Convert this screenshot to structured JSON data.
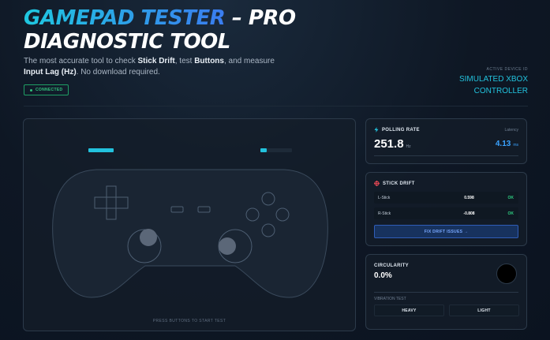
{
  "hero": {
    "title_accent": "GAMEPAD TESTER",
    "title_dash": " – PRO",
    "title_line2": "DIAGNOSTIC TOOL",
    "subtitle_parts": [
      {
        "text": "The most accurate tool to check ",
        "bold": false
      },
      {
        "text": "Stick Drift",
        "bold": true
      },
      {
        "text": ", test ",
        "bold": false
      },
      {
        "text": "Buttons",
        "bold": true
      },
      {
        "text": ", and measure ",
        "bold": false
      },
      {
        "text": "Input Lag (Hz)",
        "bold": true
      },
      {
        "text": ". No download required.",
        "bold": false
      }
    ],
    "status": "CONNECTED",
    "device_label": "ACTIVE DEVICE ID",
    "device_name": "SIMULATED XBOX CONTROLLER"
  },
  "gamepad": {
    "hint": "PRESS BUTTONS TO START TEST",
    "left_trigger": 1.0,
    "right_trigger": 0.2
  },
  "polling": {
    "title": "POLLING RATE",
    "latency_label": "Latency",
    "rate_value": "251.8",
    "rate_unit": "Hz",
    "latency_value": "4.13",
    "latency_unit": "ms"
  },
  "drift": {
    "title": "STICK DRIFT",
    "rows": [
      {
        "label": "L-Stick",
        "value": "0.598",
        "status": "OK"
      },
      {
        "label": "R-Stick",
        "value": "-0.808",
        "status": "OK"
      }
    ],
    "fix_label": "FIX DRIFT ISSUES →"
  },
  "circularity": {
    "title": "CIRCULARITY",
    "value": "0.0%",
    "vibration_label": "VIBRATION TEST",
    "heavy_label": "HEAVY",
    "light_label": "LIGHT"
  },
  "colors": {
    "accent_cyan": "#22c2dd",
    "accent_blue": "#3aa3ff",
    "ok_green": "#2fcf82"
  }
}
